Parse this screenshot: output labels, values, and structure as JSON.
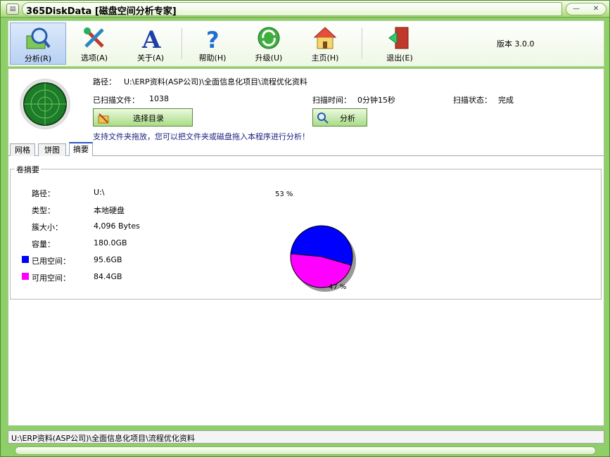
{
  "window": {
    "title": "365DiskData [磁盘空间分析专家]"
  },
  "toolbar": {
    "items": [
      {
        "label": "分析(R)",
        "icon": "magnifier-icon"
      },
      {
        "label": "选项(A)",
        "icon": "tools-icon"
      },
      {
        "label": "关于(A)",
        "icon": "about-a-icon"
      },
      {
        "label": "帮助(H)",
        "icon": "help-icon"
      },
      {
        "label": "升级(U)",
        "icon": "upgrade-icon"
      },
      {
        "label": "主页(H)",
        "icon": "home-icon"
      },
      {
        "label": "退出(E)",
        "icon": "exit-icon"
      }
    ],
    "version": "版本 3.0.0"
  },
  "scan": {
    "path_label": "路径：",
    "path_value": "U:\\ERP资料(ASP公司)\\全面信息化项目\\流程优化资料",
    "files_label": "已扫描文件：",
    "files_value": "1038",
    "time_label": "扫描时间：",
    "time_value": "0分钟15秒",
    "status_label": "扫描状态：",
    "status_value": "完成",
    "select_button": "选择目录",
    "analyze_button": "分析",
    "hint": "支持文件夹拖放，您可以把文件夹或磁盘拖入本程序进行分析！"
  },
  "tabs": [
    "网格",
    "饼图",
    "摘要"
  ],
  "summary": {
    "group_title": "卷摘要",
    "rows": [
      {
        "label": "路径：",
        "value": "U:\\"
      },
      {
        "label": "类型：",
        "value": "本地硬盘"
      },
      {
        "label": "簇大小：",
        "value": "4,096 Bytes"
      },
      {
        "label": "容量：",
        "value": "180.0GB"
      },
      {
        "label": "已用空间：",
        "value": "95.6GB"
      },
      {
        "label": "可用空间：",
        "value": "84.4GB"
      }
    ],
    "used_color": "#0000ff",
    "free_color": "#ff00ff"
  },
  "chart_data": {
    "type": "pie",
    "categories": [
      "已用空间",
      "可用空间"
    ],
    "values": [
      53,
      47
    ],
    "labels": [
      "53 %",
      "47 %"
    ],
    "colors": [
      "#0000ff",
      "#ff00ff"
    ]
  },
  "statusbar": {
    "text": "U:\\ERP资料(ASP公司)\\全面信息化项目\\流程优化资料"
  }
}
